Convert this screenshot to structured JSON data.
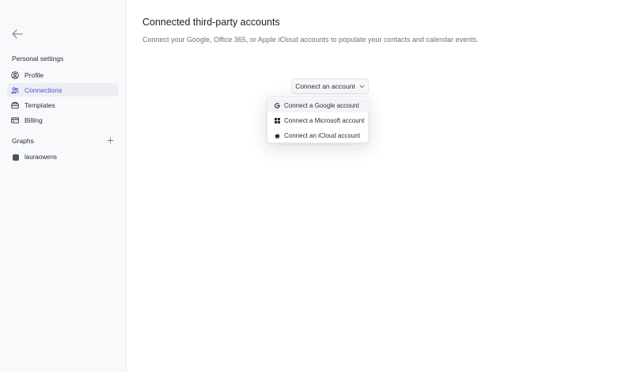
{
  "sidebar": {
    "section_label": "Personal settings",
    "items": [
      {
        "label": "Profile",
        "icon": "user-circle-icon",
        "active": false
      },
      {
        "label": "Connections",
        "icon": "users-icon",
        "active": true
      },
      {
        "label": "Templates",
        "icon": "template-icon",
        "active": false
      },
      {
        "label": "Billing",
        "icon": "credit-card-icon",
        "active": false
      }
    ],
    "graphs_label": "Graphs",
    "graphs": [
      {
        "label": "lauraowens"
      }
    ]
  },
  "main": {
    "title": "Connected third-party accounts",
    "description": "Connect your Google, Office 365, or Apple iCloud accounts to populate your contacts and calendar events.",
    "connect_button_label": "Connect an account",
    "dropdown": [
      {
        "label": "Connect a Google account",
        "icon": "google-icon"
      },
      {
        "label": "Connect a Microsoft account",
        "icon": "microsoft-icon"
      },
      {
        "label": "Connect an iCloud account",
        "icon": "apple-icon"
      }
    ]
  },
  "colors": {
    "accent": "#5a4fd0",
    "sidebar_bg": "#f8f9fb",
    "active_bg": "#eceef3"
  }
}
